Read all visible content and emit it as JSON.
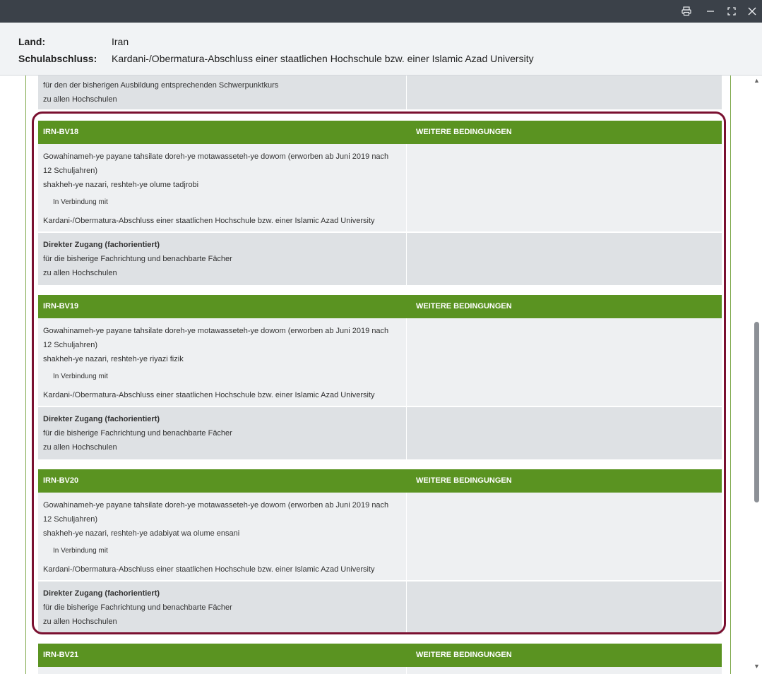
{
  "titlebar": {
    "icons": [
      "printer-icon",
      "minimize-icon",
      "maximize-icon",
      "close-icon"
    ]
  },
  "header": {
    "land_label": "Land:",
    "land_value": "Iran",
    "schulabschluss_label": "Schulabschluss:",
    "schulabschluss_value": "Kardani-/Obermatura-Abschluss einer staatlichen Hochschule bzw. einer Islamic Azad University"
  },
  "partial_top": {
    "line1": "für den der bisherigen Ausbildung entsprechenden Schwerpunktkurs",
    "line2": "zu allen Hochschulen"
  },
  "blocks": [
    {
      "code": "IRN-BV18",
      "weitere": "WEITERE BEDINGUNGEN",
      "qual_line1": "Gowahinameh-ye payane tahsilate doreh-ye motawasseteh-ye dowom (erworben ab Juni 2019 nach",
      "qual_line2": "12 Schuljahren)",
      "track": "shakheh-ye nazari, reshteh-ye olume tadjrobi",
      "verbindung": "In Verbindung mit",
      "combined": "Kardani-/Obermatura-Abschluss einer staatlichen Hochschule bzw. einer Islamic Azad University",
      "access_title": "Direkter Zugang (fachorientiert)",
      "access_line1": "für die bisherige Fachrichtung und benachbarte Fächer",
      "access_line2": "zu allen Hochschulen"
    },
    {
      "code": "IRN-BV19",
      "weitere": "WEITERE BEDINGUNGEN",
      "qual_line1": "Gowahinameh-ye payane tahsilate doreh-ye motawasseteh-ye dowom (erworben ab Juni 2019 nach",
      "qual_line2": "12 Schuljahren)",
      "track": "shakheh-ye nazari, reshteh-ye riyazi fizik",
      "verbindung": "In Verbindung mit",
      "combined": "Kardani-/Obermatura-Abschluss einer staatlichen Hochschule bzw. einer Islamic Azad University",
      "access_title": "Direkter Zugang (fachorientiert)",
      "access_line1": "für die bisherige Fachrichtung und benachbarte Fächer",
      "access_line2": "zu allen Hochschulen"
    },
    {
      "code": "IRN-BV20",
      "weitere": "WEITERE BEDINGUNGEN",
      "qual_line1": "Gowahinameh-ye payane tahsilate doreh-ye motawasseteh-ye dowom (erworben ab Juni 2019 nach",
      "qual_line2": "12 Schuljahren)",
      "track": "shakheh-ye nazari, reshteh-ye adabiyat wa olume ensani",
      "verbindung": "In Verbindung mit",
      "combined": "Kardani-/Obermatura-Abschluss einer staatlichen Hochschule bzw. einer Islamic Azad University",
      "access_title": "Direkter Zugang (fachorientiert)",
      "access_line1": "für die bisherige Fachrichtung und benachbarte Fächer",
      "access_line2": "zu allen Hochschulen"
    }
  ],
  "next_block": {
    "code": "IRN-BV21",
    "weitere": "WEITERE BEDINGUNGEN"
  },
  "colors": {
    "header_green": "#5a9321",
    "highlight_border": "#7a1030",
    "titlebar": "#3b4149"
  }
}
